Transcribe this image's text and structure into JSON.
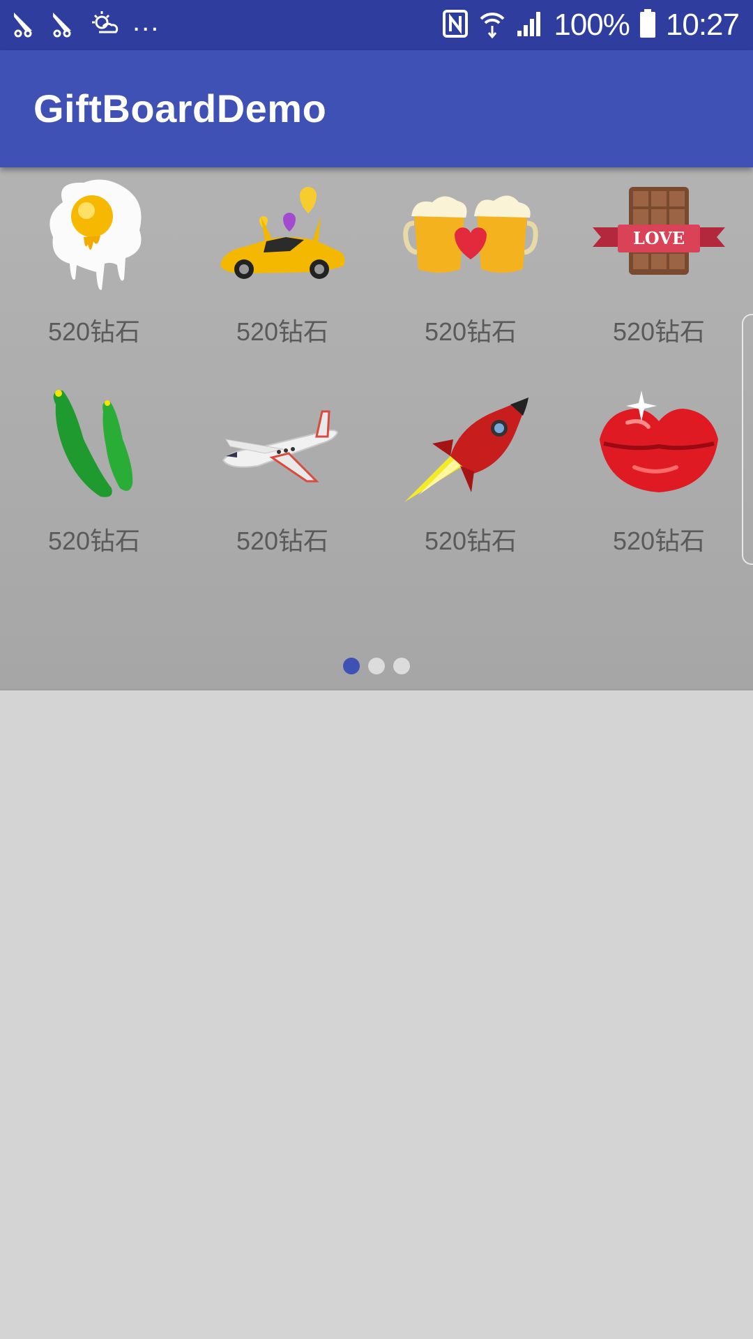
{
  "status_bar": {
    "battery": "100%",
    "time": "10:27",
    "overflow": "...",
    "icons": [
      "notification-icon",
      "notification-icon",
      "weather-icon",
      "nfc-icon",
      "wifi-icon",
      "signal-icon",
      "battery-icon"
    ]
  },
  "app_bar": {
    "title": "GiftBoardDemo"
  },
  "gifts": [
    {
      "icon": "fried-egg-icon",
      "price": "520钻石"
    },
    {
      "icon": "sports-car-icon",
      "price": "520钻石"
    },
    {
      "icon": "beer-cheers-icon",
      "price": "520钻石"
    },
    {
      "icon": "love-chocolate-icon",
      "price": "520钻石"
    },
    {
      "icon": "cucumber-icon",
      "price": "520钻石"
    },
    {
      "icon": "private-jet-icon",
      "price": "520钻石"
    },
    {
      "icon": "rocket-icon",
      "price": "520钻石"
    },
    {
      "icon": "kiss-lips-icon",
      "price": "520钻石"
    }
  ],
  "pager": {
    "pages": 3,
    "current_page": 1
  },
  "colors": {
    "primary": "#3f51b5",
    "primary_dark": "#2f3e9e",
    "background": "#d4d4d4"
  }
}
